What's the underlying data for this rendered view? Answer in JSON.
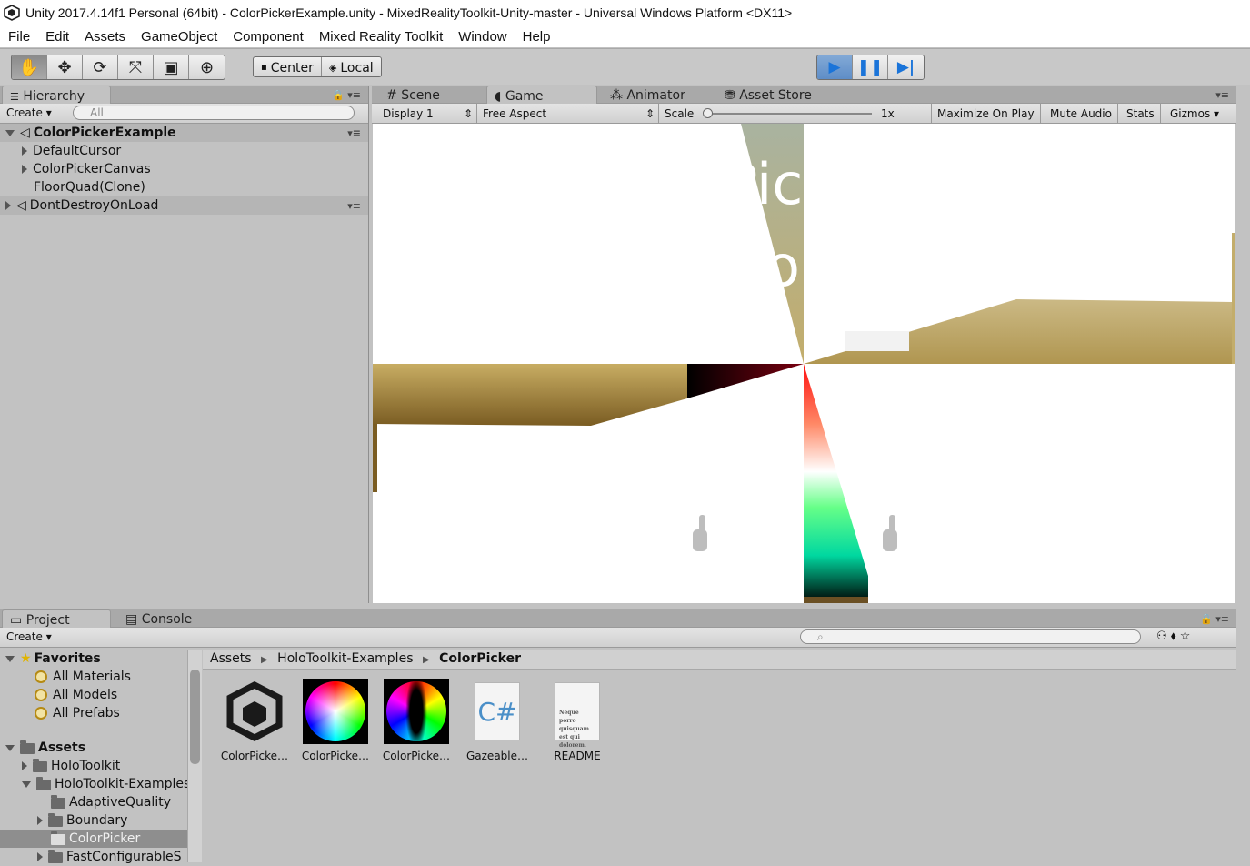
{
  "window": {
    "title": "Unity 2017.4.14f1 Personal (64bit) - ColorPickerExample.unity - MixedRealityToolkit-Unity-master - Universal Windows Platform <DX11>"
  },
  "menu": [
    "File",
    "Edit",
    "Assets",
    "GameObject",
    "Component",
    "Mixed Reality Toolkit",
    "Window",
    "Help"
  ],
  "toolbar": {
    "pivot_label": "Center",
    "space_label": "Local"
  },
  "hierarchy": {
    "tab_label": "Hierarchy",
    "create_label": "Create",
    "search_placeholder": "All",
    "scene_name": "ColorPickerExample",
    "children": [
      "DefaultCursor",
      "ColorPickerCanvas",
      "FloorQuad(Clone)"
    ],
    "dont_destroy": "DontDestroyOnLoad"
  },
  "center_tabs": {
    "scene": "Scene",
    "game": "Game",
    "animator": "Animator",
    "asset_store": "Asset Store"
  },
  "gamebar": {
    "display": "Display 1",
    "aspect": "Free Aspect",
    "scale_label": "Scale",
    "scale_value": "1x",
    "maximize": "Maximize On Play",
    "mute": "Mute Audio",
    "stats": "Stats",
    "gizmos": "Gizmos"
  },
  "project": {
    "tab_label": "Project",
    "console_label": "Console",
    "create_label": "Create",
    "favorites_label": "Favorites",
    "favorites": [
      "All Materials",
      "All Models",
      "All Prefabs"
    ],
    "assets_label": "Assets",
    "tree": [
      {
        "label": "HoloToolkit"
      },
      {
        "label": "HoloToolkit-Examples"
      },
      {
        "label": "AdaptiveQuality"
      },
      {
        "label": "Boundary"
      },
      {
        "label": "ColorPicker"
      },
      {
        "label": "FastConfigurableS"
      }
    ],
    "breadcrumb": [
      "Assets",
      "HoloToolkit-Examples",
      "ColorPicker"
    ],
    "assets": [
      "ColorPicke…",
      "ColorPicke…",
      "ColorPicke…",
      "Gazeable…",
      "README"
    ],
    "readme_thumb_text": "Neque porro quisquam est qui dolorem."
  }
}
